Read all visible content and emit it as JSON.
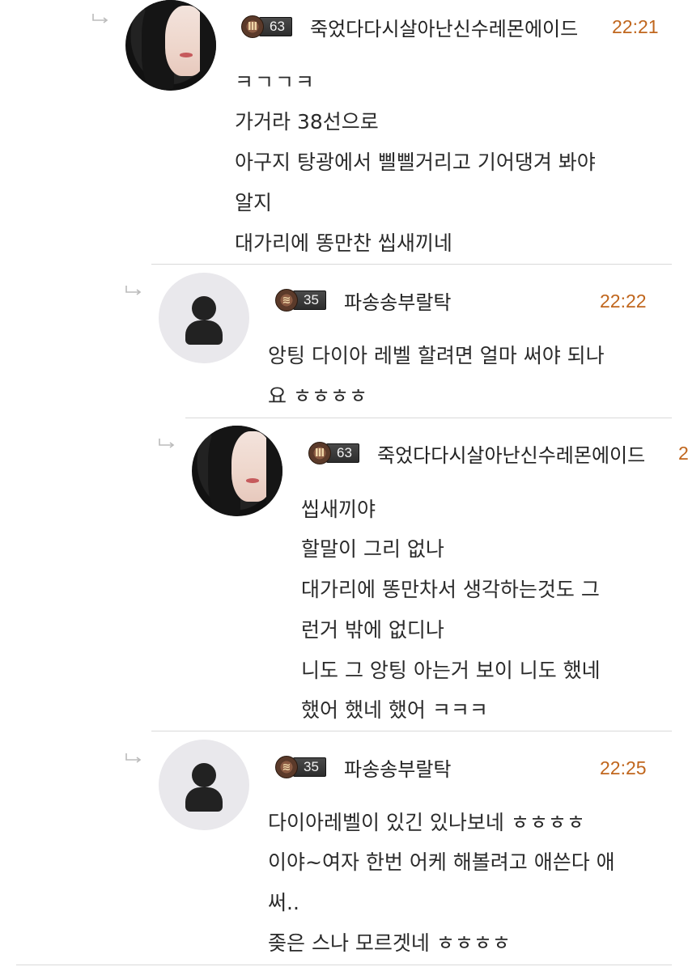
{
  "comments": [
    {
      "author": "죽었다다시살아난신수레몬에이드",
      "level": "63",
      "time": "22:21",
      "avatar": "profile-photo",
      "lines": [
        "ㅋㄱㄱㅋ",
        "가거라 38선으로",
        "아구지 탕광에서 삘삘거리고 기어댕겨  봐야",
        "알지",
        "대가리에 똥만찬 씹새끼네"
      ]
    },
    {
      "author": "파송송부랄탁",
      "level": "35",
      "time": "22:22",
      "avatar": "default-user-icon",
      "lines": [
        "앙팅 다이아 레벨 할려면 얼마 써야 되나",
        "요 ㅎㅎㅎㅎ"
      ]
    },
    {
      "author": "죽었다다시살아난신수레몬에이드",
      "level": "63",
      "time": "2",
      "avatar": "profile-photo",
      "lines": [
        "씹새끼야",
        "할말이 그리 없나",
        "대가리에 똥만차서 생각하는것도 그",
        "런거 밖에 없디나",
        "니도 그 앙팅 아는거 보이 니도 했네",
        "했어 했네 했어 ㅋㅋㅋ"
      ]
    },
    {
      "author": "파송송부랄탁",
      "level": "35",
      "time": "22:25",
      "avatar": "default-user-icon",
      "lines": [
        "다이아레벨이 있긴 있나보네 ㅎㅎㅎㅎ",
        "이야~여자 한번 어케 해볼려고 애쓴다 애",
        "써..",
        "좆은 스나 모르겟네 ㅎㅎㅎㅎ"
      ]
    }
  ],
  "icons": {
    "reply": "reply-arrow-icon",
    "rank": "rank-emblem-icon"
  },
  "colors": {
    "time": "#c0661d",
    "divider": "#d9d9d9"
  }
}
